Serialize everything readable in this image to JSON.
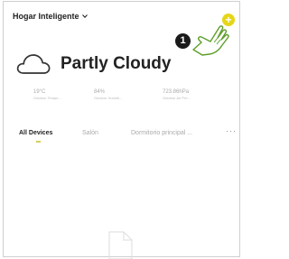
{
  "header": {
    "home_name": "Hogar Inteligente",
    "add_device_label": "+"
  },
  "tutorial": {
    "step_number": "1"
  },
  "weather": {
    "condition": "Partly Cloudy",
    "stats": [
      {
        "value": "19°C",
        "label": "Outdoor Tempe..."
      },
      {
        "value": "84%",
        "label": "Outdoor Humidi..."
      },
      {
        "value": "723.86hPa",
        "label": "Outdoor Air Pre..."
      }
    ]
  },
  "tabs": {
    "items": [
      {
        "label": "All Devices",
        "active": true
      },
      {
        "label": "Salón",
        "active": false
      },
      {
        "label": "Dormitorio principal ...",
        "active": false
      }
    ],
    "more_label": "···"
  }
}
